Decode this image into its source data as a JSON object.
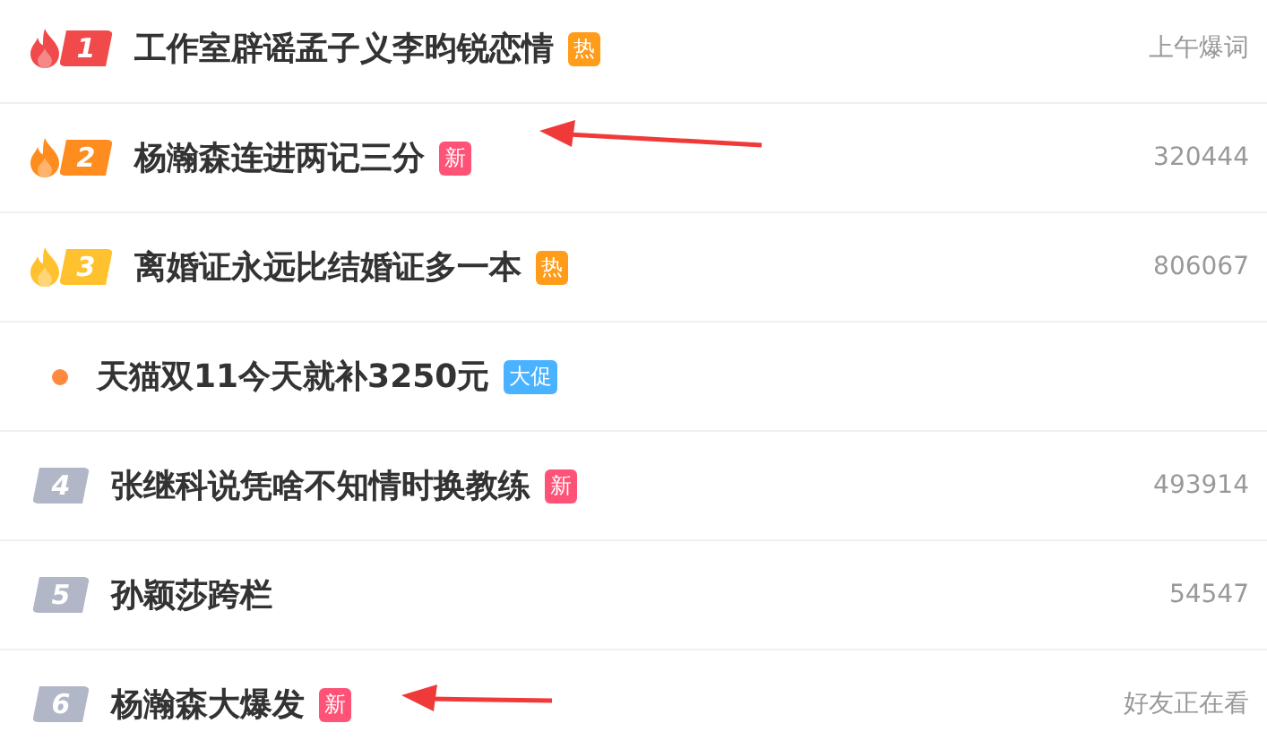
{
  "hot_list": [
    {
      "kind": "flame",
      "rank": "1",
      "color": "#f04a4a",
      "title": "工作室辟谣孟子义李昀锐恋情",
      "tag": {
        "label": "热",
        "color": "#ff9c1a"
      },
      "note": "上午爆词",
      "arrow": false
    },
    {
      "kind": "flame",
      "rank": "2",
      "color": "#ff8c1f",
      "title": "杨瀚森连进两记三分",
      "tag": {
        "label": "新",
        "color": "#ff5277"
      },
      "note": "320444",
      "arrow": true
    },
    {
      "kind": "flame",
      "rank": "3",
      "color": "#ffc12e",
      "title": "离婚证永远比结婚证多一本",
      "tag": {
        "label": "热",
        "color": "#ff9c1a"
      },
      "note": "806067",
      "arrow": false
    },
    {
      "kind": "dot",
      "color": "#ff8a3d",
      "title": "天猫双11今天就补3250元",
      "tag": {
        "label": "大促",
        "color": "#4ab3ff"
      },
      "arrow": false
    },
    {
      "kind": "plain",
      "rank": "4",
      "color": "#b2b7c8",
      "title": "张继科说凭啥不知情时换教练",
      "tag": {
        "label": "新",
        "color": "#ff5277"
      },
      "note": "493914",
      "arrow": false
    },
    {
      "kind": "plain",
      "rank": "5",
      "color": "#b2b7c8",
      "title": "孙颖莎跨栏",
      "note": "54547",
      "arrow": false
    },
    {
      "kind": "plain",
      "rank": "6",
      "color": "#b2b7c8",
      "title": "杨瀚森大爆发",
      "tag": {
        "label": "新",
        "color": "#ff5277"
      },
      "note": "好友正在看",
      "arrow": true
    }
  ]
}
